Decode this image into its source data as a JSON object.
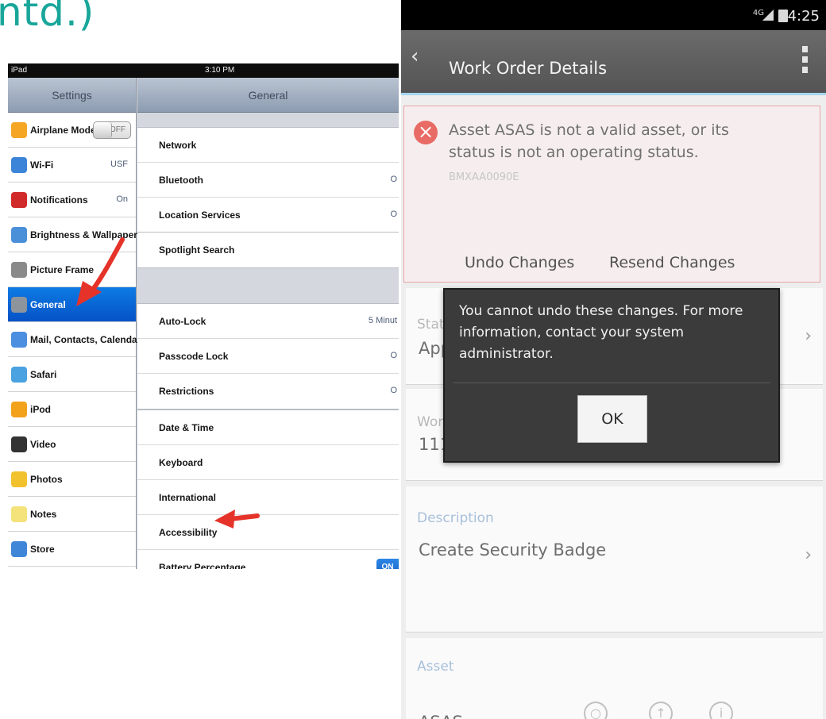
{
  "slide_title_fragment": "ntd.)",
  "ipad": {
    "status": {
      "carrier": "iPad",
      "time": "3:10 PM"
    },
    "master_title": "Settings",
    "detail_title": "General",
    "sidebar": [
      {
        "label": "Airplane Mode",
        "toggle": "OFF",
        "icon": "airplane-icon",
        "color": "#f5a623"
      },
      {
        "label": "Wi-Fi",
        "value": "USF",
        "icon": "wifi-icon",
        "color": "#3b84d8"
      },
      {
        "label": "Notifications",
        "value": "On",
        "icon": "notifications-icon",
        "color": "#d12a2a"
      },
      {
        "label": "Brightness & Wallpaper",
        "icon": "brightness-icon",
        "color": "#4a90d9"
      },
      {
        "label": "Picture Frame",
        "icon": "picture-frame-icon",
        "color": "#8a8a8a"
      },
      {
        "label": "General",
        "selected": true,
        "icon": "gear-icon",
        "color": "#8d949c"
      },
      {
        "label": "Mail, Contacts, Calendars",
        "icon": "mail-icon",
        "color": "#4c8fe0"
      },
      {
        "label": "Safari",
        "icon": "safari-icon",
        "color": "#4aa2e0"
      },
      {
        "label": "iPod",
        "icon": "ipod-icon",
        "color": "#f3a21c"
      },
      {
        "label": "Video",
        "icon": "video-icon",
        "color": "#333333"
      },
      {
        "label": "Photos",
        "icon": "photos-icon",
        "color": "#f2c12e"
      },
      {
        "label": "Notes",
        "icon": "notes-icon",
        "color": "#f4e27a"
      },
      {
        "label": "Store",
        "icon": "store-icon",
        "color": "#3f86d8"
      }
    ],
    "groups": [
      [
        {
          "label": "Network"
        },
        {
          "label": "Bluetooth",
          "value": "O"
        },
        {
          "label": "Location Services",
          "value": "O"
        }
      ],
      [
        {
          "label": "Spotlight Search"
        }
      ],
      [
        {
          "label": "Auto-Lock",
          "value": "5 Minut"
        },
        {
          "label": "Passcode Lock",
          "value": "O"
        },
        {
          "label": "Restrictions",
          "value": "O"
        }
      ],
      [
        {
          "label": "Date & Time"
        },
        {
          "label": "Keyboard"
        },
        {
          "label": "International"
        },
        {
          "label": "Accessibility"
        },
        {
          "label": "Battery Percentage",
          "toggle": "ON"
        }
      ]
    ]
  },
  "android": {
    "status": {
      "network": "4G",
      "time": "4:25"
    },
    "action_bar": {
      "title": "Work Order Details"
    },
    "error": {
      "message": "Asset ASAS is not a valid asset, or its status is not an operating status.",
      "code": "BMXAA0090E",
      "undo_label": "Undo Changes",
      "resend_label": "Resend Changes"
    },
    "fields": {
      "status_label": "Stat",
      "status_value": "App",
      "wo_label": "Wor",
      "wo_value": "111",
      "description_label": "Description",
      "description_value": "Create Security Badge",
      "asset_label": "Asset",
      "asset_value": "ASAS"
    },
    "dialog": {
      "message": "You cannot undo these changes. For more information, contact your system administrator.",
      "ok_label": "OK"
    },
    "colors": {
      "accent": "#a6d7ef",
      "error": "#e86b66"
    }
  }
}
